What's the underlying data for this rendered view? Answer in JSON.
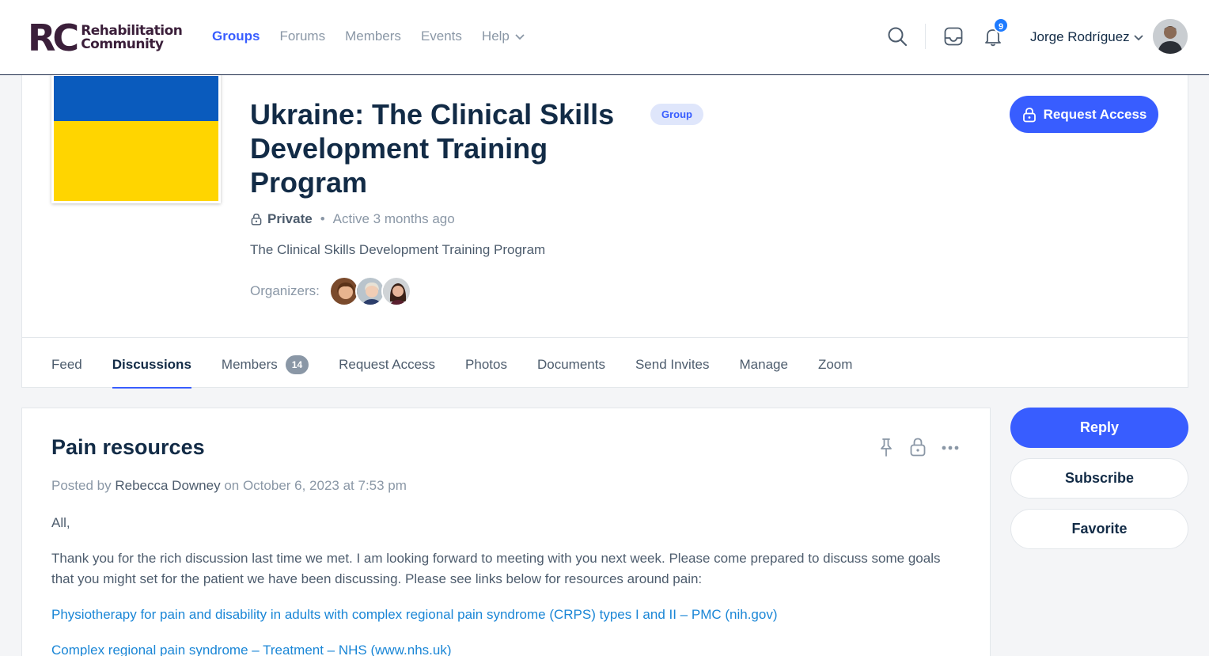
{
  "header": {
    "logo": {
      "mark": "RC",
      "line1": "Rehabilitation",
      "line2": "Community"
    },
    "nav": [
      {
        "label": "Groups",
        "active": true
      },
      {
        "label": "Forums"
      },
      {
        "label": "Members"
      },
      {
        "label": "Events"
      },
      {
        "label": "Help"
      }
    ],
    "notifications_count": "9",
    "user_name": "Jorge Rodríguez",
    "accent_color": "#385dff"
  },
  "group": {
    "title": "Ukraine: The Clinical Skills Development Training Program",
    "tag": "Group",
    "request_access_label": "Request Access",
    "privacy": "Private",
    "activity": "Active 3 months ago",
    "description": "The Clinical Skills Development Training Program",
    "organizers_label": "Organizers:",
    "tabs": [
      {
        "label": "Feed"
      },
      {
        "label": "Discussions",
        "active": true
      },
      {
        "label": "Members",
        "count": "14"
      },
      {
        "label": "Request Access"
      },
      {
        "label": "Photos"
      },
      {
        "label": "Documents"
      },
      {
        "label": "Send Invites"
      },
      {
        "label": "Manage"
      },
      {
        "label": "Zoom"
      }
    ]
  },
  "post": {
    "title": "Pain resources",
    "posted_prefix": "Posted by",
    "author": "Rebecca Downey",
    "date_text": "on October 6, 2023 at 7:53 pm",
    "greeting": "All,",
    "body": "Thank you for the rich discussion last time we met. I am looking forward to meeting with you next week. Please come prepared to discuss some goals that you might set for the patient we have been discussing. Please see links below for resources around pain:",
    "links": [
      "Physiotherapy for pain and disability in adults with complex regional pain syndrome (CRPS) types I and II – PMC (nih.gov)",
      "Complex regional pain syndrome – Treatment – NHS (www.nhs.uk)"
    ]
  },
  "sidebar": {
    "reply_label": "Reply",
    "subscribe_label": "Subscribe",
    "favorite_label": "Favorite"
  }
}
